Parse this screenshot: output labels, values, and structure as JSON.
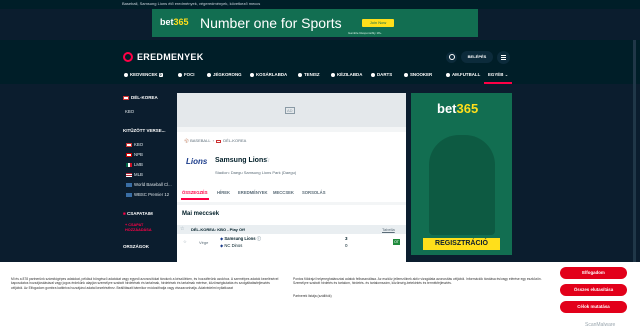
{
  "topbar": {
    "text": "Baseball, Samsung Lions élő eredmények, végeredmények, következő meccs"
  },
  "banner": {
    "logo_a": "bet",
    "logo_b": "365",
    "headline": "Number one for Sports",
    "join": "Join Now",
    "small": "Gamble Responsibly  18+"
  },
  "header": {
    "brand": "EREDMENYEK",
    "login": "BELÉPÉS"
  },
  "nav": {
    "items": [
      "KEDVENCEK",
      "FOCI",
      "JÉGKORONG",
      "KOSÁRLABDA",
      "TENISZ",
      "KÉZILABDA",
      "DARTS",
      "SNOOKER",
      "AM.FUTBALL",
      "EGYÉB"
    ],
    "badge": "0"
  },
  "left": {
    "country_section": "DÉL-KOREA",
    "country_item": "KBO",
    "pinned_title": "KITŰZÖTT VERSE...",
    "pinned": [
      "KBO",
      "NPB",
      "LMB",
      "MLB",
      "World Baseball Cl...",
      "WBSC Premier 12"
    ],
    "teams_title": "CSAPATAIM",
    "add_team": "CSAPAT HOZZÁADÁSA",
    "countries_title": "ORSZÁGOK"
  },
  "main": {
    "ad": "AD",
    "crumb_sport": "BASEBALL",
    "crumb_country": "DÉL-KOREA",
    "team_logo": "Lions",
    "team_name": "Samsung Lions",
    "stadium": "Stadion: Daegu Samsung Lions Park (Daegu)",
    "tabs": [
      "ÖSSZEGZÉS",
      "HÍREK",
      "EREDMÉNYEK",
      "MECCSEK",
      "SORSOLÁS"
    ],
    "section_title": "Mai meccsek",
    "league": "DÉL-KOREA: KBO - Play Off",
    "table_link": "Tabella",
    "match": {
      "status": "Vége",
      "home": "Samsung Lions",
      "away": "NC Dinos",
      "home_score": "3",
      "away_score": "0",
      "odd": "OT"
    }
  },
  "right_ad": {
    "logo_a": "bet",
    "logo_b": "365",
    "cta": "REGISZTRÁCIÓ"
  },
  "consent": {
    "title_left": "Törődünk a magánéletével",
    "text_left": "Mi és a 878 partnerünk számítógépes adatokat, például böngésző adatokat vagy egyedi azonosítókat tárolunk a készüléken, és hozzáférünk azokhoz. A személyes adatok kezelésével kapcsolatos hozzájárulásával vagy jogos érdekünk alapján személyre szabott hirdetések és tartalmak, hirdetések és tartalmak mérése, közönségkutatás és szolgáltatásfejlesztés céljából. Az Elfogadom gombra kattintva hozzájárul adatai kezeléséhez. Beállításait bármikor módosíthatja vagy visszavonhatja. Adatvédelmi nyilatkozat",
    "title_right": "Mi és partnereink az alábbiak nyújtása érdekében dolgozunk fel adatokat:",
    "text_right": "Pontos földrajzi helymeghatározási adatok felhasználása. Az eszköz jellemzőinek aktív vizsgálata azonosítás céljából. Információk tárolása és/vagy elérése egy eszközön. Személyre szabott hirdetés és tartalom, hirdetés- és tartalomszám, közönség-betekintés és termékfejlesztés.",
    "list_right": "Partnerek listája (szállítók)",
    "accept": "Elfogadom",
    "reject": "Összes elutasítása",
    "settings": "Célok mutatása"
  },
  "watermark": "ScanMalware"
}
